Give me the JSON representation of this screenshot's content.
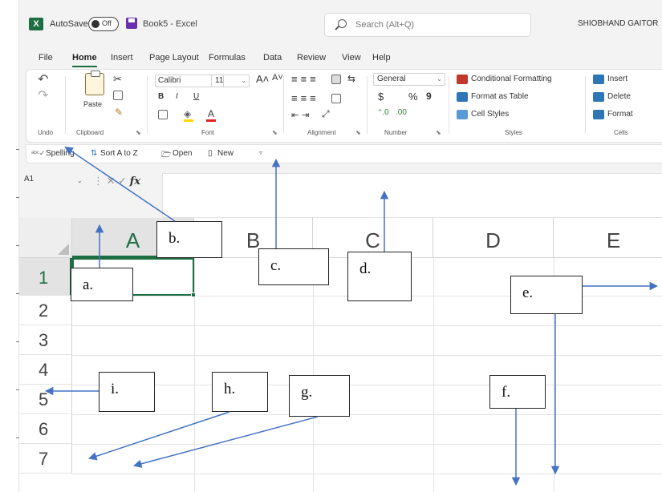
{
  "window": {
    "autosave_label": "AutoSave",
    "autosave_state": "Off",
    "doc_title": "Book5 - Excel",
    "search_placeholder": "Search (Alt+Q)",
    "user_name": "SHIOBHAND GAITOR"
  },
  "tabs": [
    "File",
    "Home",
    "Insert",
    "Page Layout",
    "Formulas",
    "Data",
    "Review",
    "View",
    "Help"
  ],
  "active_tab": "Home",
  "ribbon": {
    "undo": {
      "label": "Undo"
    },
    "clipboard": {
      "label": "Clipboard",
      "paste_label": "Paste"
    },
    "font": {
      "label": "Font",
      "font_name": "Calibri",
      "font_size": "11",
      "bold": "B",
      "italic": "I",
      "underline": "U",
      "grow": "A˄",
      "shrink": "A˅",
      "color": "A"
    },
    "alignment": {
      "label": "Alignment"
    },
    "number": {
      "label": "Number",
      "format": "General",
      "currency": "$",
      "percent": "%",
      "comma": "9"
    },
    "styles": {
      "label": "Styles",
      "conditional": "Conditional Formatting",
      "format_table": "Format as Table",
      "cell_styles": "Cell Styles"
    },
    "cells": {
      "label": "Cells",
      "insert": "Insert",
      "delete": "Delete",
      "format": "Format"
    }
  },
  "qat": {
    "spelling": "Spelling",
    "sort": "Sort A to Z",
    "open": "Open",
    "new": "New"
  },
  "formula_bar": {
    "name_box": "A1",
    "fx": "fx"
  },
  "grid": {
    "columns": [
      "A",
      "B",
      "C",
      "D",
      "E"
    ],
    "rows": [
      "1",
      "2",
      "3",
      "4",
      "5",
      "6",
      "7"
    ],
    "selected_cell": "A1"
  },
  "callouts": {
    "a": "a.",
    "b": "b.",
    "c": "c.",
    "d": "d.",
    "e": "e.",
    "f": "f.",
    "g": "g.",
    "h": "h.",
    "i": "i."
  },
  "colors": {
    "excel_green": "#1d6f42",
    "arrow_blue": "#4472c4",
    "ribbon_bg": "#ffffff",
    "chrome_bg": "#f3f3f3"
  }
}
